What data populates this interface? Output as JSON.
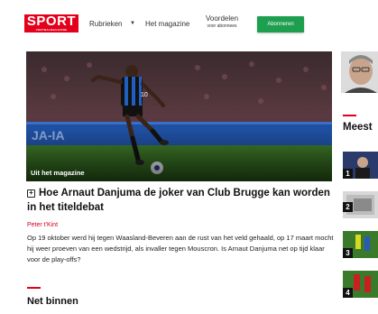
{
  "header": {
    "logo_text": "SPORT",
    "logo_subtext": "VOETBALMAGAZINE",
    "nav": {
      "rubrieken": "Rubrieken",
      "magazine": "Het magazine",
      "voordelen": "Voordelen",
      "voordelen_sub": "voor abonnees"
    },
    "subscribe_label": "Abonneren"
  },
  "article": {
    "image_label": "Uit het magazine",
    "headline_line1": "Hoe Arnaut Danjuma de joker van Club Brugge kan worden",
    "headline_line2": "in het titeldebat",
    "author": "Peter t'Kint",
    "excerpt": "Op 19 oktober werd hij tegen Waasland-Beveren aan de rust van het veld gehaald, op 17 maart mocht hij weer proeven van een wedstrijd, als invaller tegen Mouscron. Is Arnaut Danjuma net op tijd klaar voor de play-offs?",
    "jersey_number": "10"
  },
  "sections": {
    "net_binnen": "Net binnen",
    "meest": "Meest"
  },
  "most_read": [
    {
      "rank": "1"
    },
    {
      "rank": "2"
    },
    {
      "rank": "3"
    },
    {
      "rank": "4"
    }
  ],
  "colors": {
    "brand_red": "#e2001a",
    "subscribe_green": "#1e9e4f",
    "author_red": "#d0021b"
  }
}
